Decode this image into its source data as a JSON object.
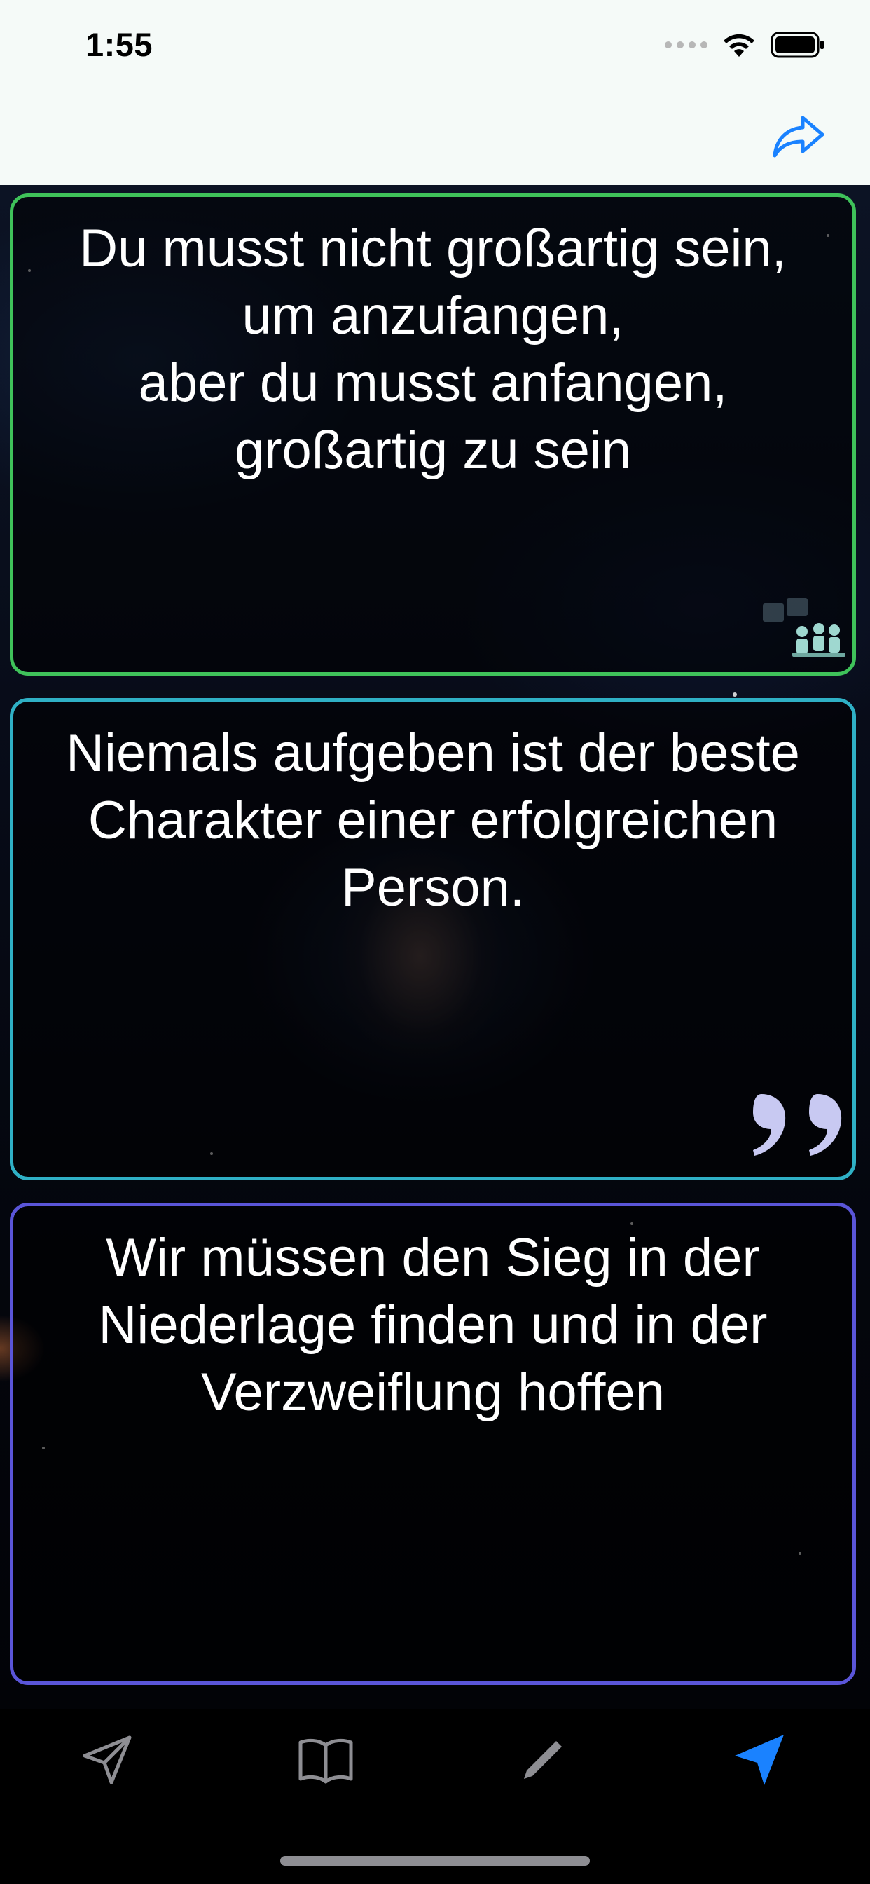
{
  "status_bar": {
    "time": "1:55"
  },
  "nav": {
    "share_icon": "share-forward-icon",
    "accent_color": "#1a82ff"
  },
  "quotes": [
    {
      "text": "Du musst nicht großartig sein,\num anzufangen,\naber du musst anfangen,\ngroßartig zu sein",
      "border_color": "#3fc25a",
      "decor_icon": "people-group-icon"
    },
    {
      "text": "Niemals aufgeben ist der beste\nCharakter einer erfolgreichen\nPerson.",
      "border_color": "#2fb0c5",
      "decor_icon": "closing-quote-icon"
    },
    {
      "text": "Wir müssen den Sieg in der\nNiederlage finden und in der\nVerzweiflung hoffen",
      "border_color": "#5a55d8"
    }
  ],
  "tab_bar": {
    "tabs": [
      {
        "icon": "paper-plane-outline-icon",
        "active": false
      },
      {
        "icon": "book-icon",
        "active": false
      },
      {
        "icon": "pencil-icon",
        "active": false
      },
      {
        "icon": "paper-plane-filled-icon",
        "active": true
      }
    ],
    "active_color": "#1a82ff",
    "inactive_color": "#8e8e93"
  }
}
